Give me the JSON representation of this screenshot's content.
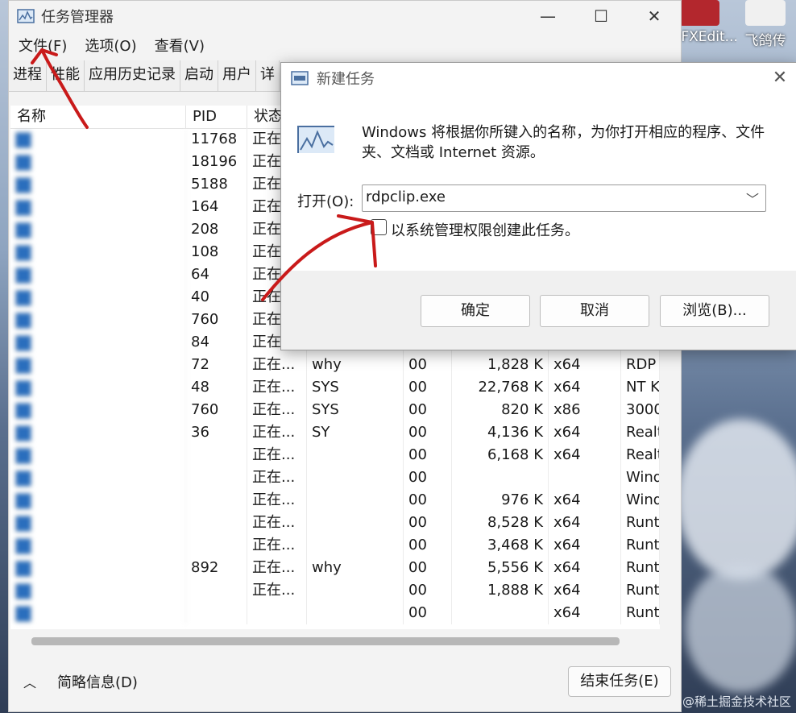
{
  "desktop": {
    "icons": [
      {
        "label": "PDFXEdit...",
        "icon": "pdf-editor-icon",
        "color": "#b3272d"
      },
      {
        "label": "飞鸽传",
        "icon": "feige-icon",
        "color": "#f0f0f0"
      }
    ],
    "watermark": "@稀土掘金技术社区"
  },
  "task_manager": {
    "title": "任务管理器",
    "window_controls": [
      "—",
      "☐",
      "✕"
    ],
    "menu": [
      "文件(F)",
      "选项(O)",
      "查看(V)"
    ],
    "tabs": [
      "进程",
      "性能",
      "应用历史记录",
      "启动",
      "用户",
      "详"
    ],
    "columns": [
      "名称",
      "PID",
      "状态"
    ],
    "rows": [
      {
        "pid": "11768",
        "status": "正在...",
        "user": "",
        "cpu": "",
        "mem": "",
        "arch": "",
        "desc": ""
      },
      {
        "pid": "18196",
        "status": "正在...",
        "user": "",
        "cpu": "",
        "mem": "",
        "arch": "",
        "desc": ""
      },
      {
        "pid": "5188",
        "status": "正在...",
        "user": "",
        "cpu": "",
        "mem": "",
        "arch": "",
        "desc": ""
      },
      {
        "pid": "164",
        "status": "正在...",
        "user": "",
        "cpu": "",
        "mem": "",
        "arch": "",
        "desc": ""
      },
      {
        "pid": "208",
        "status": "正在...",
        "user": "",
        "cpu": "",
        "mem": "",
        "arch": "",
        "desc": ""
      },
      {
        "pid": "108",
        "status": "正在...",
        "user": "",
        "cpu": "",
        "mem": "",
        "arch": "",
        "desc": ""
      },
      {
        "pid": "64",
        "status": "正在...",
        "user": "",
        "cpu": "",
        "mem": "",
        "arch": "",
        "desc": ""
      },
      {
        "pid": "40",
        "status": "正在...",
        "user": "",
        "cpu": "",
        "mem": "",
        "arch": "",
        "desc": ""
      },
      {
        "pid": "760",
        "status": "正在...",
        "user": "",
        "cpu": "",
        "mem": "",
        "arch": "",
        "desc": ""
      },
      {
        "pid": "84",
        "status": "正在...",
        "user": "",
        "cpu": "",
        "mem": "",
        "arch": "",
        "desc": ""
      },
      {
        "pid": "72",
        "status": "正在...",
        "user": "why",
        "cpu": "00",
        "mem": "1,828 K",
        "arch": "x64",
        "desc": "RDP"
      },
      {
        "pid": "48",
        "status": "正在...",
        "user": "SYS",
        "cpu": "00",
        "mem": "22,768 K",
        "arch": "x64",
        "desc": "NT K"
      },
      {
        "pid": "760",
        "status": "正在...",
        "user": "SYS",
        "cpu": "00",
        "mem": "820 K",
        "arch": "x86",
        "desc": "3000"
      },
      {
        "pid": "36",
        "status": "正在...",
        "user": "SY",
        "cpu": "00",
        "mem": "4,136 K",
        "arch": "x64",
        "desc": "Realt"
      },
      {
        "pid": "",
        "status": "正在...",
        "user": "",
        "cpu": "00",
        "mem": "6,168 K",
        "arch": "x64",
        "desc": "Realt"
      },
      {
        "pid": "",
        "status": "正在...",
        "user": "",
        "cpu": "00",
        "mem": "",
        "arch": "",
        "desc": "Wind"
      },
      {
        "pid": "",
        "status": "正在...",
        "user": "",
        "cpu": "00",
        "mem": "976 K",
        "arch": "x64",
        "desc": "Wind"
      },
      {
        "pid": "",
        "status": "正在...",
        "user": "",
        "cpu": "00",
        "mem": "8,528 K",
        "arch": "x64",
        "desc": "Runt"
      },
      {
        "pid": "",
        "status": "正在...",
        "user": "",
        "cpu": "00",
        "mem": "3,468 K",
        "arch": "x64",
        "desc": "Runt"
      },
      {
        "pid": "892",
        "status": "正在...",
        "user": "why",
        "cpu": "00",
        "mem": "5,556 K",
        "arch": "x64",
        "desc": "Runt"
      },
      {
        "pid": "",
        "status": "正在...",
        "user": "",
        "cpu": "00",
        "mem": "1,888 K",
        "arch": "x64",
        "desc": "Runt"
      },
      {
        "pid": "",
        "status": "",
        "user": "",
        "cpu": "00",
        "mem": "",
        "arch": "x64",
        "desc": "Runt"
      }
    ],
    "brief_label": "简略信息(D)",
    "end_task_label": "结束任务(E)"
  },
  "run_dialog": {
    "title": "新建任务",
    "description": "Windows 将根据你所键入的名称，为你打开相应的程序、文件夹、文档或 Internet 资源。",
    "open_label": "打开(O):",
    "open_value": "rdpclip.exe",
    "admin_checkbox_label": "以系统管理权限创建此任务。",
    "admin_checked": false,
    "buttons": {
      "ok": "确定",
      "cancel": "取消",
      "browse": "浏览(B)..."
    }
  }
}
